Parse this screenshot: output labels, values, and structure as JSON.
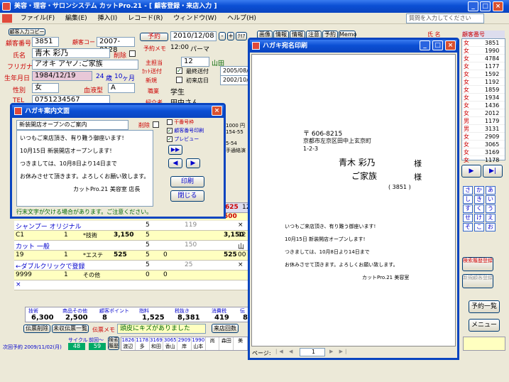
{
  "app": {
    "title": "美容・理容・サロンシステム カットPro.21 - [ 顧客登録・来店入力 ]",
    "help_placeholder": "質問を入力してください",
    "menu": [
      "ファイル(F)",
      "編集(E)",
      "挿入(I)",
      "レコード(R)",
      "ウィンドウ(W)",
      "ヘルプ(H)"
    ]
  },
  "customer": {
    "copy_btn": "顧客入力コピー",
    "no_label": "顧客番号",
    "no": "3851",
    "code_label": "顧客コード",
    "code": "2007-0128",
    "name_label": "氏名",
    "name": "青木 彩乃",
    "del_label": "削除",
    "kana_label": "フリガナ",
    "kana": "アオキ アヤノ:ご家族",
    "birth_label": "生年月日",
    "birth": "1984/12/19",
    "age": "24",
    "age_unit": "歳",
    "month": "10",
    "month_unit": "ヶ月",
    "sex_label": "性別",
    "sex": "女",
    "blood_label": "血液型",
    "blood": "A",
    "tel_label": "TEL",
    "tel": "0751234567"
  },
  "booking": {
    "btn": "予約",
    "date": "2010/12/08",
    "memo_label": "予約メモ",
    "time": "12:00",
    "menu": "パーマ",
    "staff_label": "主担当",
    "staff_no": "12",
    "staff": "山田",
    "last_label": "ｶｯﾄ送付",
    "last_visit_label": "最終送付",
    "last_date": "2005/08/0",
    "new_label": "新規",
    "first_label": "初来店日",
    "first_date": "2002/10/1",
    "job_label": "職業",
    "job": "学生",
    "intro_label": "紹介者",
    "intro": "田中さん"
  },
  "tabs": [
    "画像",
    "情報1",
    "情報2",
    "注意",
    "予約",
    "Memo"
  ],
  "right_list": {
    "h1": "氏 名",
    "h2": "顧客番号",
    "rows": [
      {
        "s": "女",
        "n": "3851"
      },
      {
        "s": "女",
        "n": "1990"
      },
      {
        "s": "女",
        "n": "4784"
      },
      {
        "s": "女",
        "n": "1177"
      },
      {
        "s": "女",
        "n": "1592"
      },
      {
        "s": "女",
        "n": "1192"
      },
      {
        "s": "女",
        "n": "1859"
      },
      {
        "s": "女",
        "n": "1934"
      },
      {
        "s": "女",
        "n": "1436"
      },
      {
        "s": "女",
        "n": "2012"
      },
      {
        "s": "男",
        "n": "1179"
      },
      {
        "s": "男",
        "n": "3131"
      },
      {
        "s": "女",
        "n": "2909"
      },
      {
        "s": "女",
        "n": "3065"
      },
      {
        "s": "女",
        "n": "3169"
      },
      {
        "s": "女",
        "n": "1178"
      }
    ]
  },
  "kana_grid": [
    "さ",
    "か",
    "あ",
    "し",
    "き",
    "い",
    "す",
    "く",
    "う",
    "せ",
    "け",
    "え",
    "そ",
    "こ",
    "お"
  ],
  "right_btns": {
    "history": "検索履歴登録",
    "new_cust": "新規顧客登録",
    "yoyaku": "予約一覧",
    "menu": "メニュー"
  },
  "dialog_info": {
    "title": "ハガキ案内文面",
    "subject": "新装開店オープンのご案内",
    "del": "削除",
    "body": [
      "いつもご来店頂き、有り難う御座います!",
      "10月15日 新装開店オープンします!",
      "つきましては、10月8日より14日まで",
      "お休みさせて頂きます。よろしくお願い致します。",
      "カットPro.21 美容室 店長"
    ],
    "opt1": "干番号枠",
    "opt2": "顧客番号印刷",
    "opt3": "プレビュー",
    "print": "印刷",
    "close": "閉じる",
    "note": "行末文字が欠ける場合があります。ご注意ください。"
  },
  "preview": {
    "title": "ハガキ宛名印刷",
    "postal": "〒 606-8215",
    "addr1": "京都市左京区田中上玄京町",
    "addr2": "1-2-3",
    "name1": "青木 彩乃",
    "honor": "様",
    "name2": "ご家族",
    "cno": "( 3851 )",
    "msg": [
      "いつもご来店頂き、有り難う御座います!",
      "10月15日 新装開店オープンします!",
      "つきましては、10月8日より14日まで",
      "お休みさせて頂きます。よろしくお願い致します。"
    ],
    "sign": "カットPro.21 美容室",
    "page_label": "ページ:",
    "page": "1"
  },
  "grid": {
    "rows": [
      {
        "name": "シャンプー オリジナル",
        "n": "5",
        "p": "119",
        "t": "",
        "m": "×"
      },
      {
        "code": "C1",
        "q": "1",
        "cat": "*技術",
        "price": "3,150",
        "n": "5",
        "t": "3,150",
        "m": "12"
      },
      {
        "name": "カット 一般",
        "n": "5",
        "p": "150",
        "m": "山田"
      },
      {
        "code": "19",
        "q": "1",
        "cat": "*エステ",
        "price": "525",
        "a": "0",
        "n": "5",
        "t": "525",
        "m": "00"
      },
      {
        "name": "←ダブルクリックで登録",
        "n": "5",
        "p": "25",
        "m": "×"
      },
      {
        "code": "9999",
        "q": "1",
        "cat": "その他",
        "n": "0",
        "a": "0"
      },
      {
        "name": "×"
      }
    ]
  },
  "totals": {
    "h": [
      "技術",
      "商品その他",
      "顧客ポイント",
      "指料",
      "税抜き",
      "消費税",
      "伝"
    ],
    "v": [
      "6,300",
      "2,500",
      "8",
      "1,525",
      "8,381",
      "419",
      "8"
    ]
  },
  "footer": {
    "del": "伝票削除",
    "new_slip": "未収伝票一覧",
    "memo_label": "伝票メモ",
    "memo": "頭皮にキズがありました",
    "count_btn": "来店回数",
    "next_label": "次回予約",
    "next": "2009/11/02(月)",
    "cycle_label": "サイクル",
    "cycle": "48",
    "visit_label": "前回～",
    "visit": "59",
    "search": "検索履歴"
  },
  "bottom_strip": [
    {
      "n": "1826",
      "s": "渡辺"
    },
    {
      "n": "1178",
      "s": "多"
    },
    {
      "n": "3169",
      "s": "和田"
    },
    {
      "n": "3065",
      "s": "香山"
    },
    {
      "n": "2909",
      "s": "岸"
    },
    {
      "n": "1990",
      "s": "山本"
    },
    {
      "n": "",
      "s": "尚"
    },
    {
      "n": "",
      "s": "森田"
    },
    {
      "n": "",
      "s": "美"
    }
  ],
  "amounts": {
    "a1": "1000 円",
    "a2": "4",
    "a3": "154-55",
    "a4": "4",
    "a5": "5-54",
    "a6": "手通絡演",
    "b1": "625",
    "b2": "12",
    "b3": "500",
    "b4": "00"
  },
  "colors": {
    "title": "#0b4fd4",
    "accent": "#c00"
  }
}
